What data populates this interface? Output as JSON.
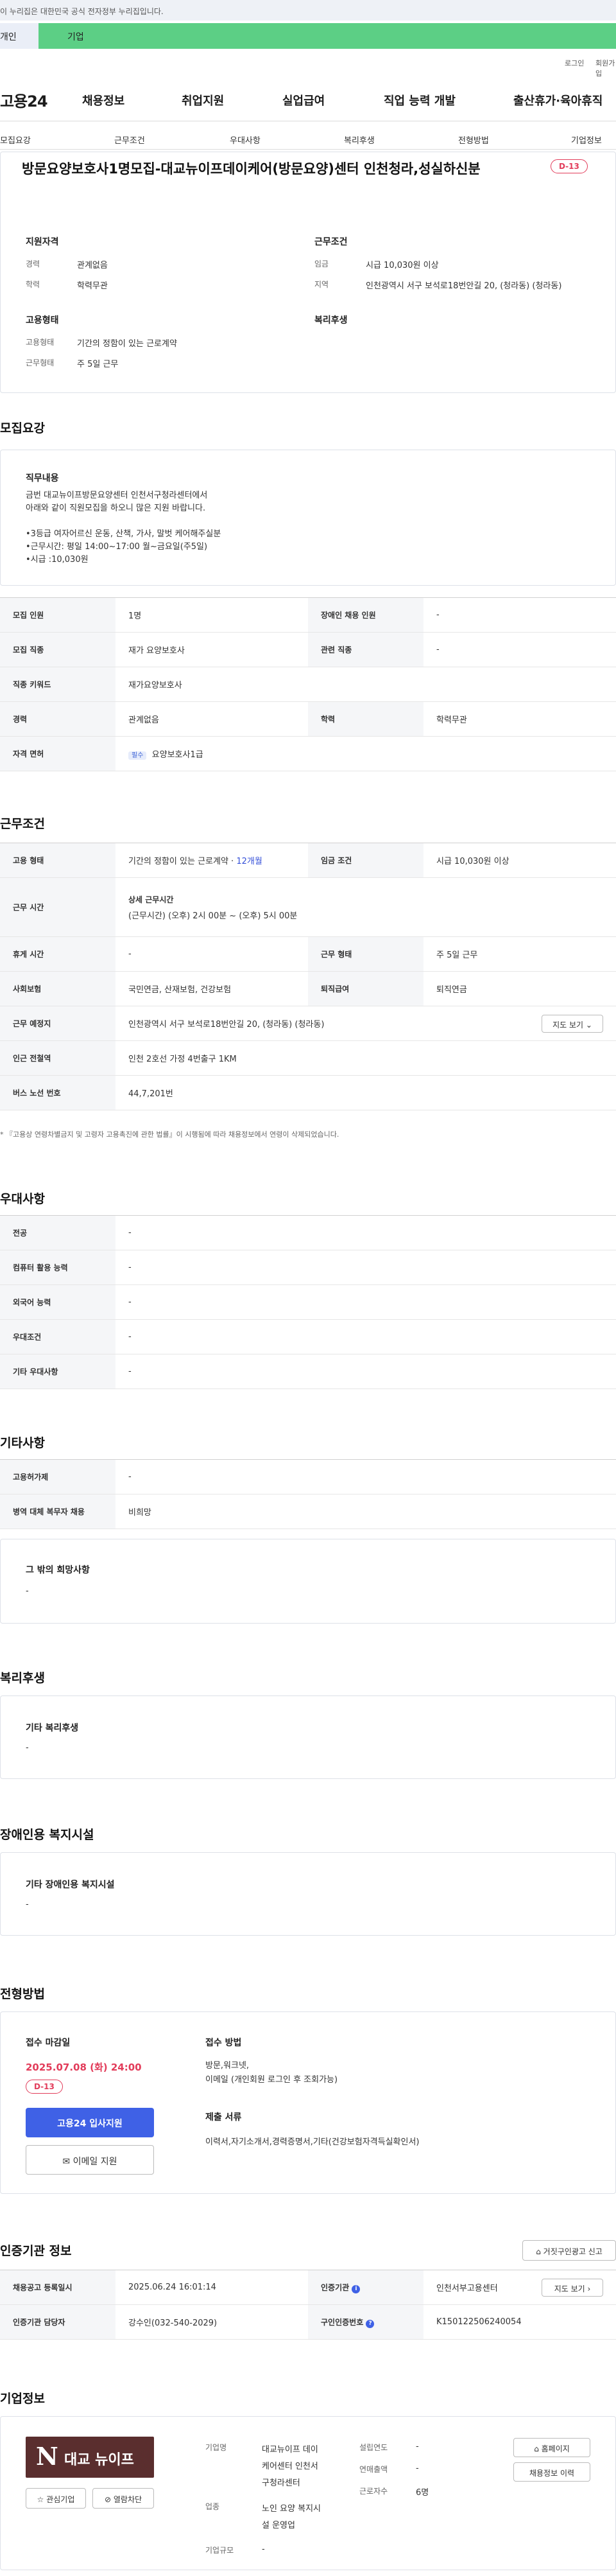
{
  "gov_notice": "이 누리집은 대한민국 공식 전자정부 누리집입니다.",
  "tabs": {
    "individual": "개인",
    "company": "기업"
  },
  "util": {
    "login": "로그인",
    "signup": "회원가입"
  },
  "logo": "고용24",
  "gnb": [
    "채용정보",
    "취업지원",
    "실업급여",
    "직업 능력 개발",
    "출산휴가·육아휴직"
  ],
  "lnb": [
    "모집요강",
    "근무조건",
    "우대사항",
    "복리후생",
    "전형방법",
    "기업정보"
  ],
  "title": "방문요양보호사1명모집-대교뉴이프데이케어(방문요양)센터 인천청라,성실하신분",
  "dday": "D-13",
  "summary": {
    "qual_title": "지원자격",
    "cond_title": "근무조건",
    "type_title": "고용형태",
    "welfare_title": "복리후생",
    "career_label": "경력",
    "career_value": "관계없음",
    "edu_label": "학력",
    "edu_value": "학력무관",
    "wage_label": "임금",
    "wage_value": "시급 10,030원 이상",
    "region_label": "지역",
    "region_value": "인천광역시 서구 보석로18번안길 20, (청라동) (청라동)",
    "emp_label": "고용형태",
    "emp_value": "기간의 정함이 있는 근로계약",
    "work_label": "근무형태",
    "work_value": "주 5일 근무"
  },
  "recruit": {
    "section": "모집요강",
    "duty_title": "직무내용",
    "duty_lines": [
      "금번 대교뉴이프방문요양센터 인천서구청라센터에서",
      "아래와 같이 직원모집을 하오니 많은 지원 바랍니다.",
      "",
      "•3등급 여자어르신 운동, 산책, 가사, 말벗 케어해주실분",
      "•근무시간: 평일 14:00~17:00 월~금요일(주5일)",
      "•시급 :10,030원"
    ],
    "rows": {
      "count_l": "모집 인원",
      "count_v": "1명",
      "disabled_l": "장애인 채용 인원",
      "disabled_v": "-",
      "job_l": "모집 직종",
      "job_v": "재가 요양보호사",
      "related_l": "관련 직종",
      "related_v": "-",
      "kw_l": "직종 키워드",
      "kw_v": "재가요양보호사",
      "career_l": "경력",
      "career_v": "관계없음",
      "edu_l": "학력",
      "edu_v": "학력무관",
      "lic_l": "자격 면허",
      "lic_pill": "필수",
      "lic_v": "요양보호사1급"
    }
  },
  "cond": {
    "section": "근무조건",
    "emp_l": "고용 형태",
    "emp_v": "기간의 정함이 있는 근로계약 · ",
    "emp_months": "12개월",
    "wage_l": "임금 조건",
    "wage_v": "시급 10,030원 이상",
    "time_l": "근무 시간",
    "time_title": "상세 근무시간",
    "time_v": "(근무시간) (오후) 2시 00분 ~ (오후) 5시 00분",
    "rest_l": "휴게 시간",
    "rest_v": "-",
    "form_l": "근무 형태",
    "form_v": "주 5일 근무",
    "ins_l": "사회보험",
    "ins_v": "국민연금, 산재보험, 건강보험",
    "ret_l": "퇴직급여",
    "ret_v": "퇴직연금",
    "place_l": "근무 예정지",
    "place_v": "인천광역시 서구 보석로18번안길 20, (청라동) (청라동)",
    "map_btn": "지도 보기",
    "subway_l": "인근 전철역",
    "subway_v": "인천 2호선 가정 4번출구 1KM",
    "bus_l": "버스 노선 번호",
    "bus_v": "44,7,201번",
    "note": "* 『고용상 연령차별금지 및 고령자 고용촉진에 관한 법률』이 시행됨에 따라 채용정보에서 연령이 삭제되었습니다."
  },
  "pref": {
    "section": "우대사항",
    "major_l": "전공",
    "major_v": "-",
    "pc_l": "컴퓨터 활용 능력",
    "pc_v": "-",
    "lang_l": "외국어 능력",
    "lang_v": "-",
    "cond_l": "우대조건",
    "cond_v": "-",
    "etc_l": "기타 우대사항",
    "etc_v": "-"
  },
  "other": {
    "section": "기타사항",
    "sup_l": "고용허가제",
    "sup_v": "-",
    "mil_l": "병역 대체 복무자 채용",
    "mil_v": "비희망",
    "wish_title": "그 밖의 희망사항",
    "wish_v": "-"
  },
  "welfare": {
    "section": "복리후생",
    "title": "기타 복리후생",
    "v": "-"
  },
  "disabled": {
    "section": "장애인용 복지시설",
    "title": "기타 장애인용 복지시설",
    "v": "-"
  },
  "process": {
    "section": "전형방법",
    "deadline_title": "접수 마감일",
    "deadline": "2025.07.08 (화) 24:00",
    "dday": "D-13",
    "apply_btn": "고용24 입사지원",
    "email_btn": "이메일 지원",
    "method_title": "접수 방법",
    "method_lines": [
      "방문,워크넷,",
      "이메일 (개인회원 로그인 후 조회가능)"
    ],
    "doc_title": "제출 서류",
    "doc_v": "이력서,자기소개서,경력증명서,기타(건강보험자격득실확인서)"
  },
  "cert": {
    "section": "인증기관 정보",
    "report_btn": "거짓구인광고 신고",
    "reg_l": "채용공고 등록일시",
    "reg_v": "2025.06.24 16:01:14",
    "org_l": "인증기관",
    "org_v": "인천서부고용센터",
    "map_btn": "지도 보기",
    "mgr_l": "인증기관 담당자",
    "mgr_v": "강수인(032-540-2029)",
    "no_l": "구인인증번호",
    "no_v": "K150122506240054"
  },
  "company": {
    "section": "기업정보",
    "logo_text": "대교 뉴이프",
    "logo_mark": "N",
    "fav_btn": "관심기업",
    "block_btn": "열람차단",
    "name_l": "기업명",
    "name_lines": [
      "대교뉴이프 데이",
      "케어센터 인천서",
      "구청라센터"
    ],
    "ind_l": "업종",
    "ind_lines": [
      "노인 요양 복지시",
      "설 운영업"
    ],
    "size_l": "기업규모",
    "size_v": "-",
    "est_l": "설립연도",
    "est_v": "-",
    "rev_l": "연매출액",
    "rev_v": "-",
    "emp_l": "근로자수",
    "emp_v": "6명",
    "home_btn": "홈페이지",
    "jobs_btn": "채용정보 이력"
  },
  "colors": {
    "accent": "#3550d8",
    "danger": "#e23c5a",
    "green": "#5ccf85"
  }
}
